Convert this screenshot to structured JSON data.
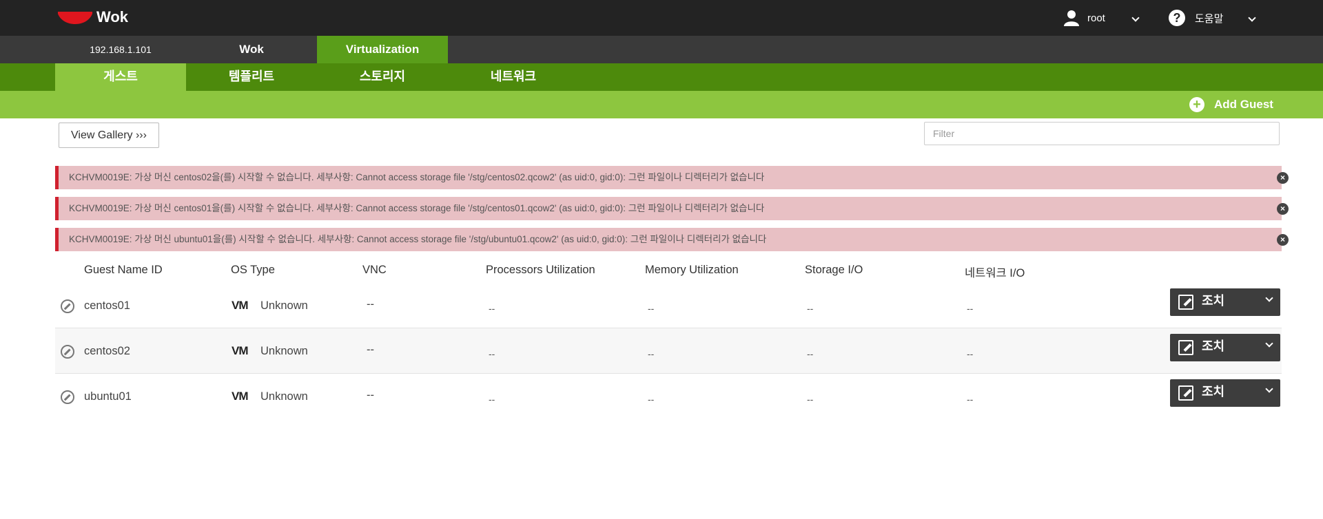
{
  "header": {
    "app_name": "Wok",
    "user": "root",
    "help": "도움말"
  },
  "host_tabs": [
    "192.168.1.101",
    "Wok",
    "Virtualization"
  ],
  "sub_tabs": [
    "게스트",
    "템플리트",
    "스토리지",
    "네트워크"
  ],
  "action_bar": {
    "add_guest": "Add Guest"
  },
  "toolbar": {
    "view_gallery": "View Gallery ›››",
    "filter_placeholder": "Filter"
  },
  "alerts": [
    "KCHVM0019E: 가상 머신 centos02을(를) 시작할 수 없습니다. 세부사항: Cannot access storage file '/stg/centos02.qcow2' (as uid:0, gid:0): 그런 파일이나 디렉터리가 없습니다",
    "KCHVM0019E: 가상 머신 centos01을(를) 시작할 수 없습니다. 세부사항: Cannot access storage file '/stg/centos01.qcow2' (as uid:0, gid:0): 그런 파일이나 디렉터리가 없습니다",
    "KCHVM0019E: 가상 머신 ubuntu01을(를) 시작할 수 없습니다. 세부사항: Cannot access storage file '/stg/ubuntu01.qcow2' (as uid:0, gid:0): 그런 파일이나 디렉터리가 없습니다"
  ],
  "table": {
    "columns": [
      "Guest Name ID",
      "OS Type",
      "VNC",
      "Processors Utilization",
      "Memory Utilization",
      "Storage I/O",
      "네트워크 I/O"
    ],
    "rows": [
      {
        "name": "centos01",
        "vm_badge": "VM",
        "os": "Unknown",
        "vnc": "--",
        "cpu": "--",
        "mem": "--",
        "storage": "--",
        "network": "--",
        "action": "조치"
      },
      {
        "name": "centos02",
        "vm_badge": "VM",
        "os": "Unknown",
        "vnc": "--",
        "cpu": "--",
        "mem": "--",
        "storage": "--",
        "network": "--",
        "action": "조치"
      },
      {
        "name": "ubuntu01",
        "vm_badge": "VM",
        "os": "Unknown",
        "vnc": "--",
        "cpu": "--",
        "mem": "--",
        "storage": "--",
        "network": "--",
        "action": "조치"
      }
    ]
  },
  "colors": {
    "header_bg": "#232323",
    "host_bar_bg": "#3a3a3a",
    "host_active_bg": "#5a9e1a",
    "sub_bar_bg": "#4d8a0c",
    "sub_active_bg": "#8dc63f",
    "alert_bg": "#e8c0c4",
    "alert_border": "#d0212f",
    "action_btn_bg": "#3d3d3d"
  }
}
